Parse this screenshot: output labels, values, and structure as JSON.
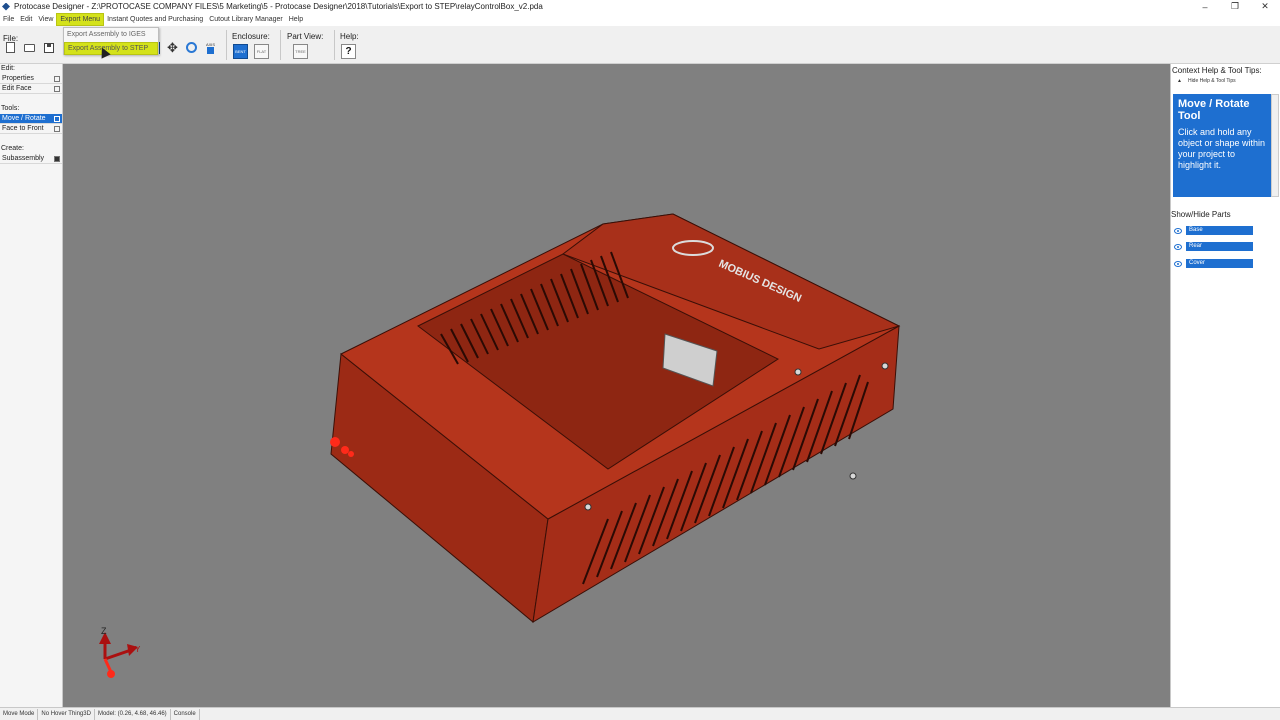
{
  "window": {
    "title": "Protocase Designer - Z:\\PROTOCASE COMPANY FILES\\5 Marketing\\5 - Protocase Designer\\2018\\Tutorials\\Export to STEP\\relayControlBox_v2.pda",
    "minimize": "–",
    "maximize": "❐",
    "close": "✕"
  },
  "menu": {
    "items": [
      "File",
      "Edit",
      "View",
      "Export Menu",
      "Instant Quotes and Purchasing",
      "Cutout Library Manager",
      "Help"
    ],
    "active_index": 3
  },
  "export_dropdown": {
    "items": [
      "Export Assembly to IGES",
      "Export Assembly to STEP"
    ],
    "active_index": 1
  },
  "toolbar": {
    "file_label": "File:",
    "enclosure_label": "Enclosure:",
    "enclosure_bent": "BENT",
    "enclosure_flat": "FLAT",
    "part_view_label": "Part View:",
    "part_view_tree": "TREE",
    "help_label": "Help:",
    "help_glyph": "?",
    "axis_label": "AXIS"
  },
  "left_panel": {
    "edit_heading": "Edit:",
    "edit_items": [
      "Properties",
      "Edit Face"
    ],
    "tools_heading": "Tools:",
    "tools_items": [
      "Move / Rotate",
      "Face to Front"
    ],
    "create_heading": "Create:",
    "create_items": [
      "Subassembly"
    ]
  },
  "right_panel": {
    "title": "Context Help & Tool Tips:",
    "hide_link": "Hide Help & Tool Tips",
    "tip_title": "Move / Rotate Tool",
    "tip_body": "Click and hold any object or shape within your project to highlight it.",
    "show_hide_title": "Show/Hide Parts",
    "parts": [
      "Base",
      "Rear",
      "Cover"
    ],
    "part_color": "#1e6fd0"
  },
  "viewport": {
    "background": "#808080",
    "enclosure_color": "#b0301a",
    "brand_text": "MOBIUS DESIGN",
    "axis_z": "Z",
    "axis_y": "Y"
  },
  "status_bar": {
    "mode": "Move Mode",
    "hover": "No Hover Thing3D",
    "model": "Model: (0.26, 4.68, 46.46)",
    "console": "Console"
  }
}
